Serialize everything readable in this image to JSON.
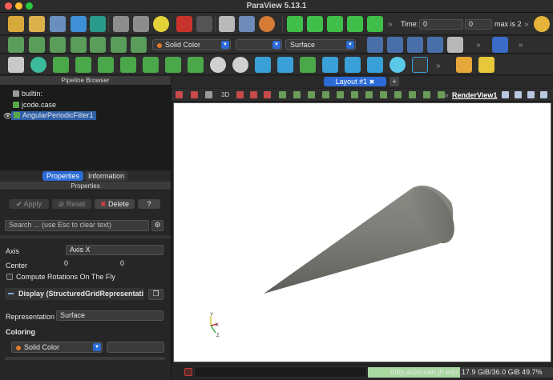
{
  "window": {
    "title": "ParaView 5.13.1"
  },
  "toolbar1": {
    "time_label": "Time:",
    "time_value": "0",
    "timestep_value": "0",
    "max_label": "max is 2"
  },
  "toolbar2": {
    "color_combo": "Solid Color",
    "representation_combo": "Surface"
  },
  "pipeline": {
    "header": "Pipeline Browser",
    "items": [
      {
        "label": "builtin:"
      },
      {
        "label": "jcode.case"
      },
      {
        "label": "AngularPeriodicFilter1"
      }
    ]
  },
  "tabs": {
    "properties": "Properties",
    "information": "Information"
  },
  "properties": {
    "header": "Properties",
    "apply": "Apply",
    "reset": "Reset",
    "delete": "Delete",
    "help": "?",
    "search_placeholder": "Search ... (use Esc to clear text)",
    "axis_label": "Axis",
    "axis_value": "Axis X",
    "center_label": "Center",
    "center_x": "0",
    "center_y": "0",
    "compute_label": "Compute Rotations On The Fly",
    "display_label": "Display (StructuredGridRepresentati",
    "representation_label": "Representation",
    "representation_value": "Surface",
    "coloring_label": "Coloring",
    "coloring_value": "Solid Color"
  },
  "layout": {
    "tab_label": "Layout #1",
    "add_tab": "+",
    "render_view": "RenderView1",
    "view_3d": "3D"
  },
  "axes": {
    "y": "Y",
    "x": "X",
    "z": "Z"
  },
  "status": {
    "memory_text": "mbp.acasmart.jh.edu: 17.9 GiB/36.0 GiB 49.7%",
    "memory_percent": 49.7
  },
  "colors": {
    "accent": "#2c6bd6",
    "selection": "#2f5fa8",
    "memory_fill": "#a8d8a0",
    "object": "#7d7c77"
  }
}
